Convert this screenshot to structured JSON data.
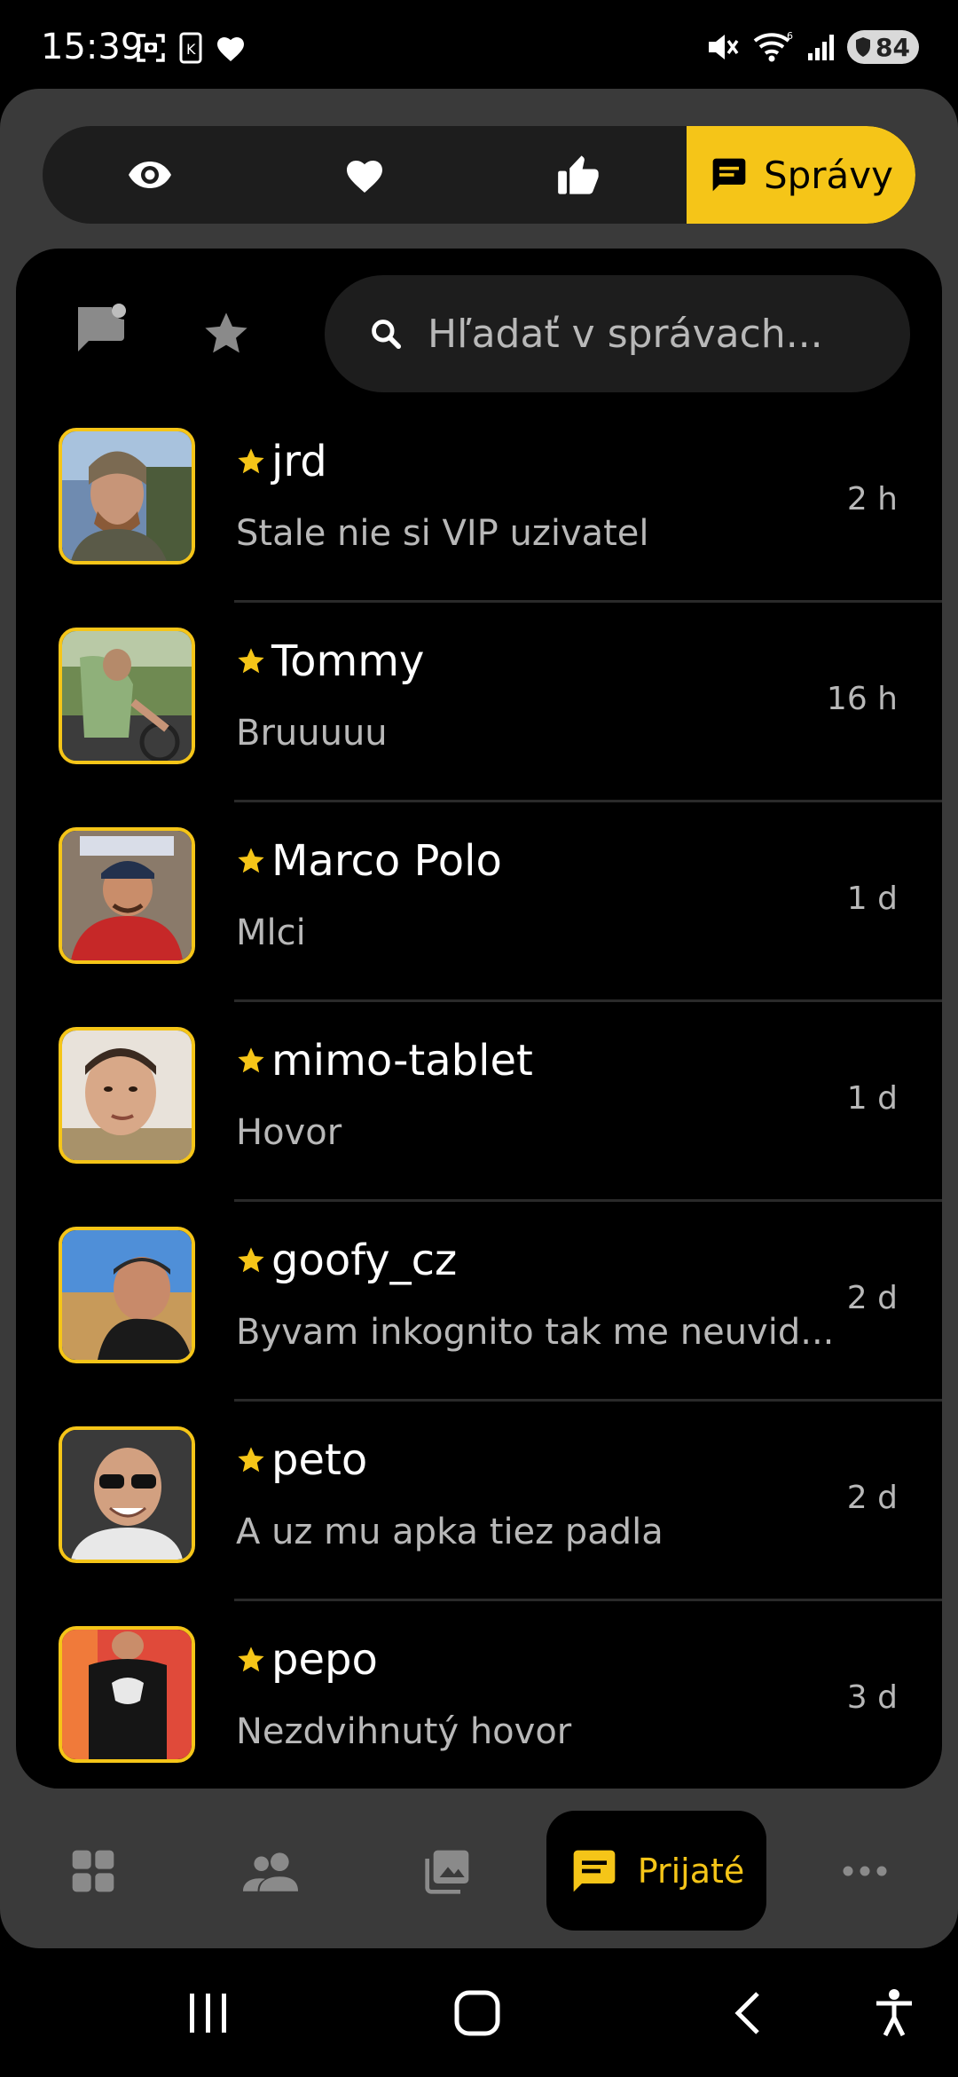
{
  "status_bar": {
    "time": "15:39",
    "battery_level": "84"
  },
  "top_tabs": {
    "items": [
      {
        "icon": "eye-icon"
      },
      {
        "icon": "heart-icon"
      },
      {
        "icon": "thumbs-up-icon"
      }
    ],
    "active": {
      "icon": "message-icon",
      "label": "Správy"
    }
  },
  "tools": {
    "search_placeholder": "Hľadať v správach..."
  },
  "conversations": [
    {
      "name": "jrd",
      "preview": "Stale nie si VIP uzivatel",
      "time": "2 h"
    },
    {
      "name": "Tommy",
      "preview": "Bruuuuu",
      "time": "16 h"
    },
    {
      "name": "Marco Polo",
      "preview": "Mlci",
      "time": "1 d"
    },
    {
      "name": "mimo-tablet",
      "preview": "Hovor",
      "time": "1 d"
    },
    {
      "name": "goofy_cz",
      "preview": "Byvam inkognito tak me neuvid...",
      "time": "2 d"
    },
    {
      "name": "peto",
      "preview": "A uz mu apka tiez padla",
      "time": "2 d"
    },
    {
      "name": "pepo",
      "preview": "Nezdvihnutý hovor",
      "time": "3 d"
    }
  ],
  "bottom_nav": {
    "active_label": "Prijaté"
  },
  "colors": {
    "accent": "#f5c518",
    "frame": "#3a3a3a",
    "panel": "#000000",
    "muted_text": "#b8b8b8"
  }
}
